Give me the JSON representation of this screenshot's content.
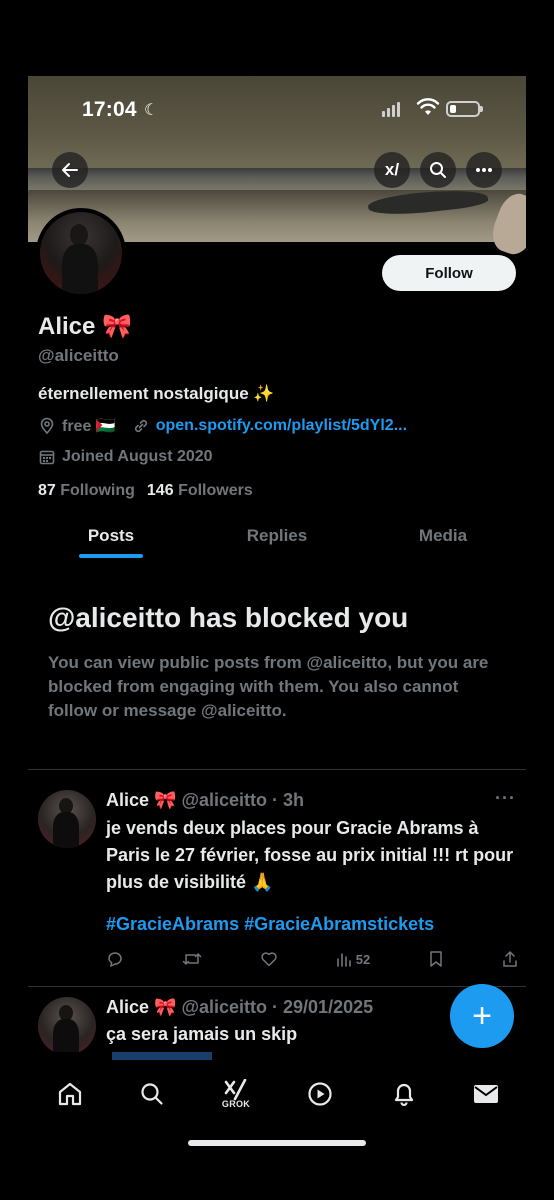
{
  "status_bar": {
    "time": "17:04"
  },
  "header": {
    "back_icon": "arrow-left-icon",
    "grok_icon": "xai-icon",
    "search_icon": "search-icon",
    "more_icon": "more-horizontal-icon"
  },
  "profile": {
    "follow_label": "Follow",
    "display_name": "Alice 🎀",
    "handle": "@aliceitto",
    "bio": "éternellement nostalgique ✨",
    "location": "free 🇵🇸",
    "link": "open.spotify.com/playlist/5dYl2...",
    "joined": "Joined August 2020",
    "following_count": "87",
    "following_label": "Following",
    "followers_count": "146",
    "followers_label": "Followers"
  },
  "tabs": [
    {
      "label": "Posts",
      "active": true
    },
    {
      "label": "Replies",
      "active": false
    },
    {
      "label": "Media",
      "active": false
    }
  ],
  "blocked": {
    "title": "@aliceitto has blocked you",
    "description": "You can view public posts from @aliceitto, but you are blocked from engaging with them. You also cannot follow or message @aliceitto."
  },
  "posts": [
    {
      "name": "Alice 🎀",
      "handle_time": "@aliceitto · 3h",
      "text": "je vends deux places pour Gracie Abrams à Paris le 27 février, fosse au prix initial !!! rt pour plus de visibilité 🙏",
      "tags": "#GracieAbrams #GracieAbramstickets",
      "views": "52"
    },
    {
      "name": "Alice 🎀",
      "handle_time": "@aliceitto · 29/01/2025",
      "text": "ça sera jamais un skip"
    }
  ],
  "fab": {
    "icon": "compose-plus-icon",
    "label": "+"
  },
  "bottom_nav": {
    "items": [
      "home-icon",
      "search-icon",
      "grok-icon",
      "video-play-icon",
      "notifications-bell-icon",
      "messages-envelope-icon"
    ],
    "grok_label": "GROK"
  }
}
